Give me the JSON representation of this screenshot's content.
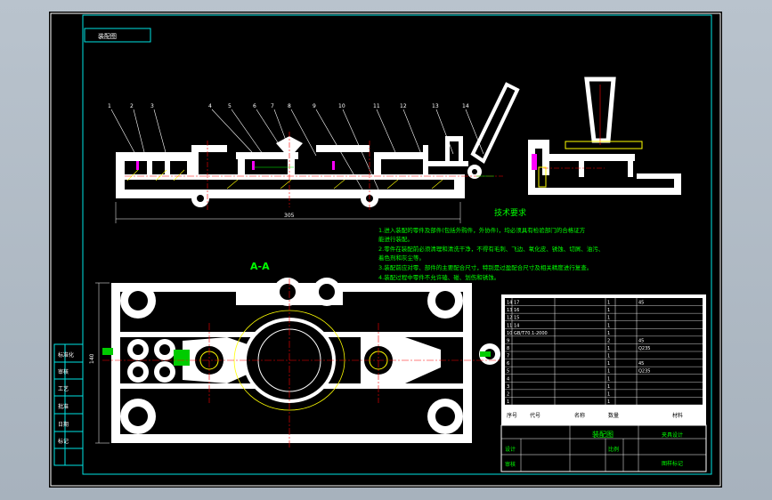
{
  "drawing": {
    "title_box": "装配图",
    "section_label": "A-A",
    "part_numbers": [
      "1",
      "2",
      "3",
      "4",
      "5",
      "6",
      "7",
      "8",
      "9",
      "10",
      "11",
      "12",
      "13",
      "14"
    ],
    "overall_dim": "305",
    "height_dim": "140",
    "tech_title": "技术要求",
    "tech_notes": [
      "1.进入装配的零件及部件(包括外购件，外协件)，均必须具有检验部门的合格证方",
      "能进行装配。",
      "2.零件在装配前必须清理和清洗干净，不得有毛刺、飞边、氧化皮、锈蚀、切屑、油污、",
      "着色剂和灰尘等。",
      "3.装配前应对零、部件的主要配合尺寸，特别是过盈配合尺寸及相关精度进行复查。",
      "4.装配过程中零件不允许磕、碰、划伤和锈蚀。"
    ],
    "left_strip": [
      "标准化",
      "审核",
      "工艺",
      "批准",
      "日期",
      "标记"
    ],
    "bom_rows": [
      [
        "14",
        "17",
        "",
        "1",
        "45"
      ],
      [
        "13",
        "16",
        "",
        "1",
        ""
      ],
      [
        "12",
        "15",
        "",
        "1",
        ""
      ],
      [
        "11",
        "14",
        "",
        "1",
        ""
      ],
      [
        "10",
        "GB/T70.1-2000",
        "",
        "1",
        ""
      ],
      [
        "9",
        "",
        "",
        "2",
        "45"
      ],
      [
        "8",
        "",
        "",
        "1",
        "Q235"
      ],
      [
        "7",
        "",
        "",
        "1",
        ""
      ],
      [
        "6",
        "",
        "",
        "1",
        "45"
      ],
      [
        "5",
        "",
        "",
        "1",
        "Q235"
      ],
      [
        "4",
        "",
        "",
        "1",
        ""
      ],
      [
        "3",
        "",
        "",
        "1",
        ""
      ],
      [
        "2",
        "",
        "",
        "1",
        ""
      ],
      [
        "1",
        "",
        "",
        "1",
        ""
      ]
    ],
    "bom_header": [
      "序号",
      "代号",
      "名称",
      "数量",
      "材料"
    ],
    "title_block": {
      "name": "装配图",
      "school": "夹具设计",
      "sheet": "图样标记",
      "drawn": "设计",
      "checked": "审核",
      "scale": "比例"
    }
  }
}
